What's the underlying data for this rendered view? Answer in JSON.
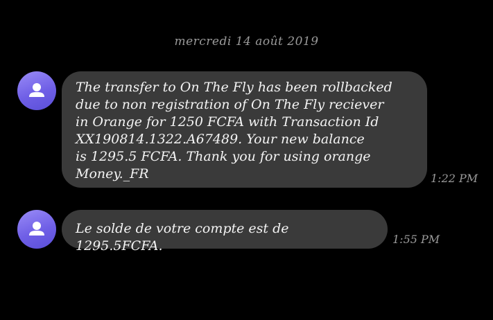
{
  "conversation": {
    "date_header": "mercredi 14 août 2019",
    "messages": [
      {
        "avatar_icon": "person-icon",
        "text": "The transfer to On The Fly has been rollbacked\ndue to non registration of On The Fly reciever\nin Orange for 1250 FCFA with Transaction Id\nXX190814.1322.A67489. Your new balance\nis 1295.5 FCFA. Thank you for using orange\nMoney._FR",
        "time": "1:22 PM"
      },
      {
        "avatar_icon": "person-icon",
        "text": "Le solde de votre compte est de 1295.5FCFA.",
        "time": "1:55 PM"
      }
    ]
  },
  "colors": {
    "background": "#000000",
    "bubble": "#3a3a3a",
    "avatar_gradient_start": "#9a8cf7",
    "avatar_gradient_end": "#5a4fd8",
    "meta_text": "#9a9a9a",
    "message_text": "#f4f4f4"
  }
}
